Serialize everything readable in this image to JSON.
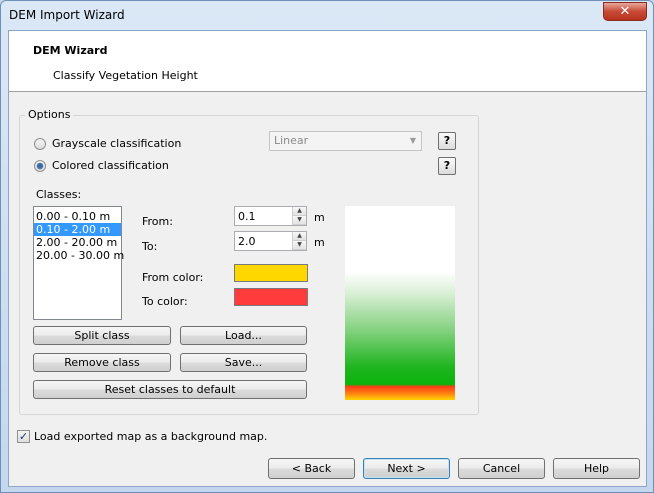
{
  "window": {
    "title": "DEM Import Wizard",
    "close_glyph": "✕"
  },
  "header": {
    "title": "DEM Wizard",
    "subtitle": "Classify Vegetation Height"
  },
  "options": {
    "legend": "Options",
    "grayscale_label": "Grayscale classification",
    "colored_label": "Colored classification",
    "selected_mode": "colored",
    "scale_select": {
      "value": "Linear",
      "enabled": false
    },
    "help_label": "?",
    "classes_label": "Classes:",
    "classes": [
      {
        "label": "0.00 - 0.10 m",
        "selected": false
      },
      {
        "label": "0.10 - 2.00 m",
        "selected": true
      },
      {
        "label": "2.00 - 20.00 m",
        "selected": false
      },
      {
        "label": "20.00 - 30.00 m",
        "selected": false
      }
    ],
    "from_label": "From:",
    "from_value": "0.1",
    "to_label": "To:",
    "to_value": "2.0",
    "unit": "m",
    "from_color_label": "From color:",
    "from_color": "#ffd700",
    "to_color_label": "To color:",
    "to_color": "#ff3b3b",
    "buttons": {
      "split": "Split class",
      "load": "Load...",
      "remove": "Remove class",
      "save": "Save...",
      "reset": "Reset classes to default"
    }
  },
  "background_map": {
    "label": "Load exported map as a background map.",
    "checked": true,
    "check_glyph": "✓"
  },
  "footer": {
    "back": "< Back",
    "next": "Next >",
    "cancel": "Cancel",
    "help": "Help"
  },
  "icons": {
    "spin_up": "▲",
    "spin_down": "▼",
    "dropdown": "▼"
  }
}
